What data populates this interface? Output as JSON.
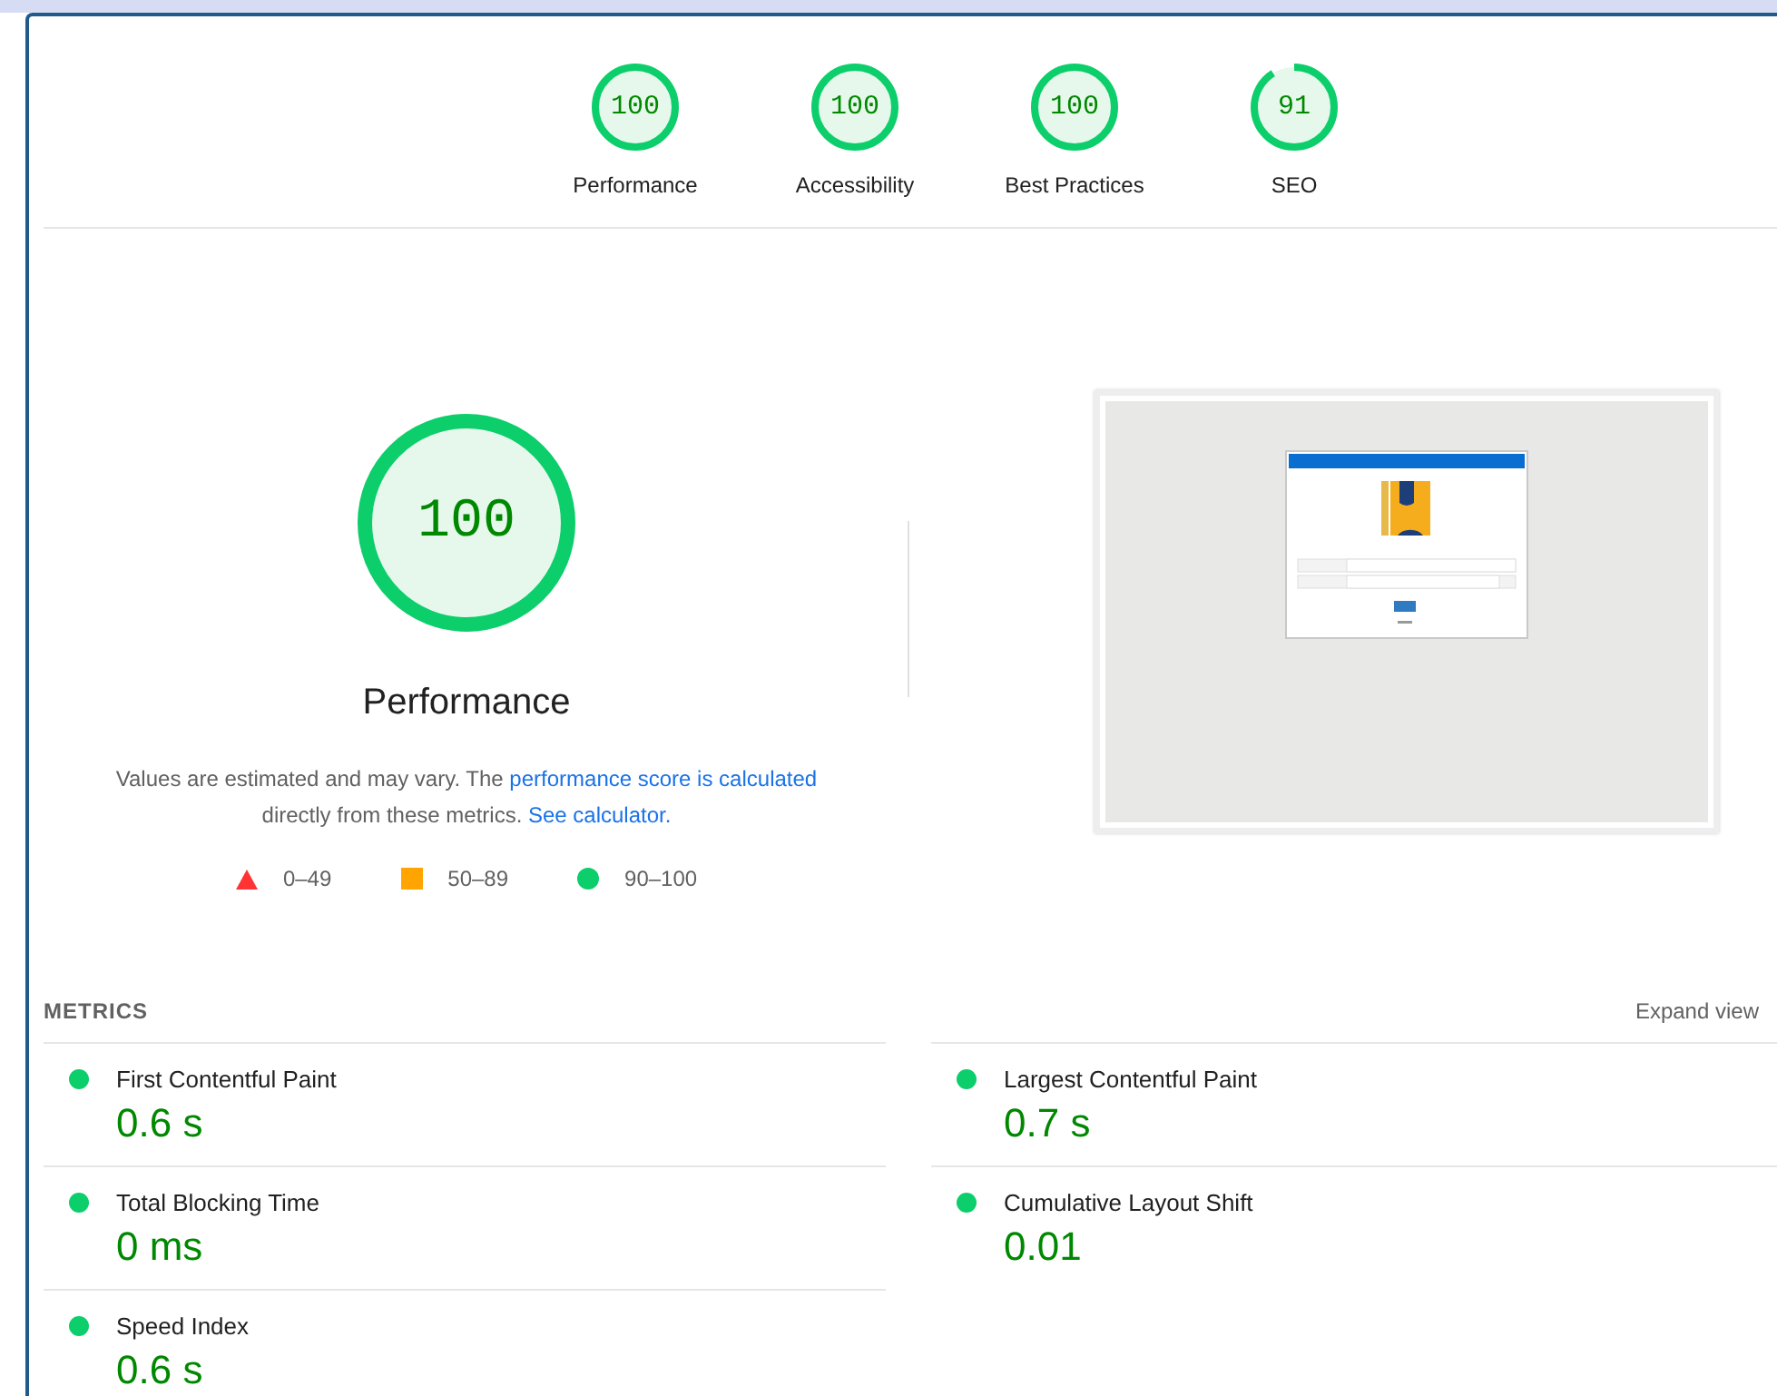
{
  "categories": [
    {
      "score": "100",
      "label": "Performance",
      "level": 1
    },
    {
      "score": "100",
      "label": "Accessibility",
      "level": 1
    },
    {
      "score": "100",
      "label": "Best Practices",
      "level": 1
    },
    {
      "score": "91",
      "label": "SEO",
      "level": 0.91
    }
  ],
  "performance": {
    "score": "100",
    "level": 1,
    "title": "Performance",
    "description": [
      {
        "kind": "text",
        "text": "Values are estimated and may vary. The "
      },
      {
        "kind": "link",
        "text": "performance score is calculated"
      },
      {
        "kind": "text",
        "text": " directly from these metrics. "
      },
      {
        "kind": "link",
        "text": "See calculator."
      }
    ],
    "legend": [
      {
        "kind": "triangle",
        "color": "#ff3333",
        "label": "0–49"
      },
      {
        "kind": "square",
        "color": "#ffa400",
        "label": "50–89"
      },
      {
        "kind": "circle",
        "color": "#0cce6b",
        "label": "90–100"
      }
    ]
  },
  "metrics": {
    "title": "METRICS",
    "toggle": "Expand view",
    "items": [
      {
        "name": "First Contentful Paint",
        "value": "0.6 s",
        "color": "#0cce6b"
      },
      {
        "name": "Largest Contentful Paint",
        "value": "0.7 s",
        "color": "#0cce6b"
      },
      {
        "name": "Total Blocking Time",
        "value": "0 ms",
        "color": "#0cce6b"
      },
      {
        "name": "Cumulative Layout Shift",
        "value": "0.01",
        "color": "#0cce6b"
      },
      {
        "name": "Speed Index",
        "value": "0.6 s",
        "color": "#0cce6b"
      }
    ]
  }
}
